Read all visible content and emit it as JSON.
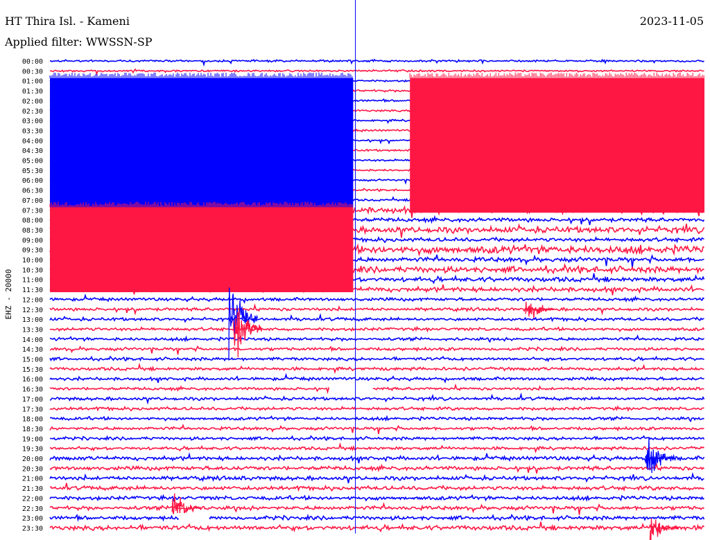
{
  "header": {
    "station": "HT Thira Isl. - Kameni",
    "filter": "Applied filter: WWSSN-SP",
    "date": "2023-11-05"
  },
  "chart_data": {
    "type": "line",
    "title": "HT Thira Isl. - Kameni",
    "subtitle": "Applied filter: WWSSN-SP",
    "ylabel": "EHZ - 20000",
    "row_labels": [
      "00:00",
      "00:30",
      "01:00",
      "01:30",
      "02:00",
      "02:30",
      "03:00",
      "03:30",
      "04:00",
      "04:30",
      "05:00",
      "05:30",
      "06:00",
      "06:30",
      "07:00",
      "07:30",
      "08:00",
      "08:30",
      "09:00",
      "09:30",
      "10:00",
      "10:30",
      "11:00",
      "11:30",
      "12:00",
      "12:30",
      "13:00",
      "13:30",
      "14:00",
      "14:30",
      "15:00",
      "15:30",
      "16:00",
      "16:30",
      "17:00",
      "17:30",
      "18:00",
      "18:30",
      "19:00",
      "19:30",
      "20:00",
      "20:30",
      "21:00",
      "21:30",
      "22:00",
      "22:30",
      "23:00",
      "23:30"
    ],
    "series_colors": [
      "#0000ff",
      "#ff1744"
    ],
    "marker_minute": 14,
    "row_noise": [
      1.3,
      1.2,
      1.2,
      1.4,
      1.3,
      1.3,
      1.3,
      1.3,
      1.3,
      1.3,
      1.3,
      1.3,
      1.3,
      1.3,
      1.3,
      4,
      2.5,
      4,
      2.5,
      5,
      3,
      4,
      3,
      3,
      2,
      2,
      2,
      2,
      2,
      2,
      2,
      2,
      2,
      1.8,
      2,
      2,
      2,
      2,
      2,
      2,
      2.5,
      2.5,
      2.5,
      2.5,
      2.5,
      2.5,
      2.5,
      3
    ],
    "saturated_blocks": [
      {
        "rows": [
          2,
          15
        ],
        "from_minute": 0,
        "to_minute": 13.9,
        "color": "#0000ff"
      },
      {
        "rows": [
          2,
          15
        ],
        "from_minute": 16.5,
        "to_minute": 30,
        "color": "#ff1744"
      },
      {
        "rows": [
          15,
          23
        ],
        "from_minute": 0,
        "to_minute": 13.9,
        "color": "#ff1744"
      }
    ],
    "events": [
      {
        "row": 26,
        "minute": 8.2,
        "amplitude": 30
      },
      {
        "row": 27,
        "minute": 8.4,
        "amplitude": 25
      },
      {
        "row": 45,
        "minute": 5.6,
        "amplitude": 16
      },
      {
        "row": 40,
        "minute": 27.3,
        "amplitude": 18
      },
      {
        "row": 47,
        "minute": 27.5,
        "amplitude": 14
      },
      {
        "row": 25,
        "minute": 21.8,
        "amplitude": 10
      }
    ],
    "gaps": [
      {
        "row": 33,
        "from_minute": 12.8,
        "to_minute": 14.8
      },
      {
        "row": 46,
        "from_minute": 5.9,
        "to_minute": 7.3
      }
    ]
  }
}
